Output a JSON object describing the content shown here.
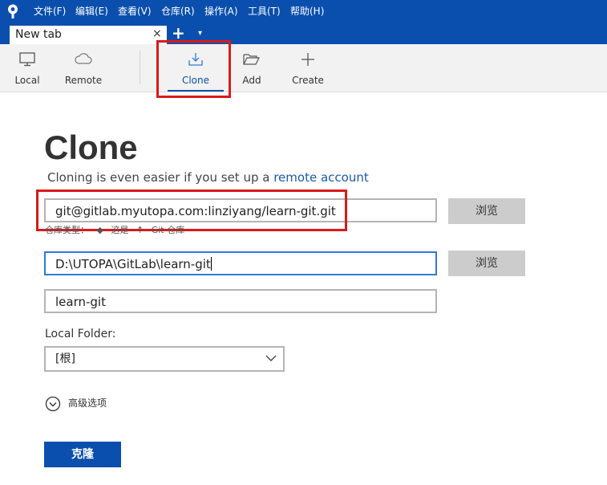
{
  "menu": {
    "items": [
      "文件(F)",
      "编辑(E)",
      "查看(V)",
      "仓库(R)",
      "操作(A)",
      "工具(T)",
      "帮助(H)"
    ]
  },
  "tabs": {
    "active_label": "New tab",
    "close_glyph": "×",
    "add_glyph": "+",
    "menu_glyph": "▾"
  },
  "toolbar": {
    "local": "Local",
    "remote": "Remote",
    "clone": "Clone",
    "add": "Add",
    "create": "Create",
    "active": "clone"
  },
  "page": {
    "title": "Clone",
    "subtitle_prefix": "Cloning is even easier if you set up a ",
    "subtitle_link": "remote account"
  },
  "form": {
    "source_url": "git@gitlab.myutopa.com:linziyang/learn-git.git",
    "repo_type_label": "仓库类型：",
    "repo_type_value": "这是",
    "repo_type_kind": "Git 仓库",
    "dest_path": "D:\\UTOPA\\GitLab\\learn-git",
    "name": "learn-git",
    "browse_label": "浏览",
    "local_folder_label": "Local Folder:",
    "local_folder_value": "[根]",
    "advanced_label": "高级选项",
    "clone_button": "克隆"
  },
  "colors": {
    "brand": "#0a4fad",
    "highlight": "#d91a1a",
    "focus": "#2e7bd6"
  }
}
